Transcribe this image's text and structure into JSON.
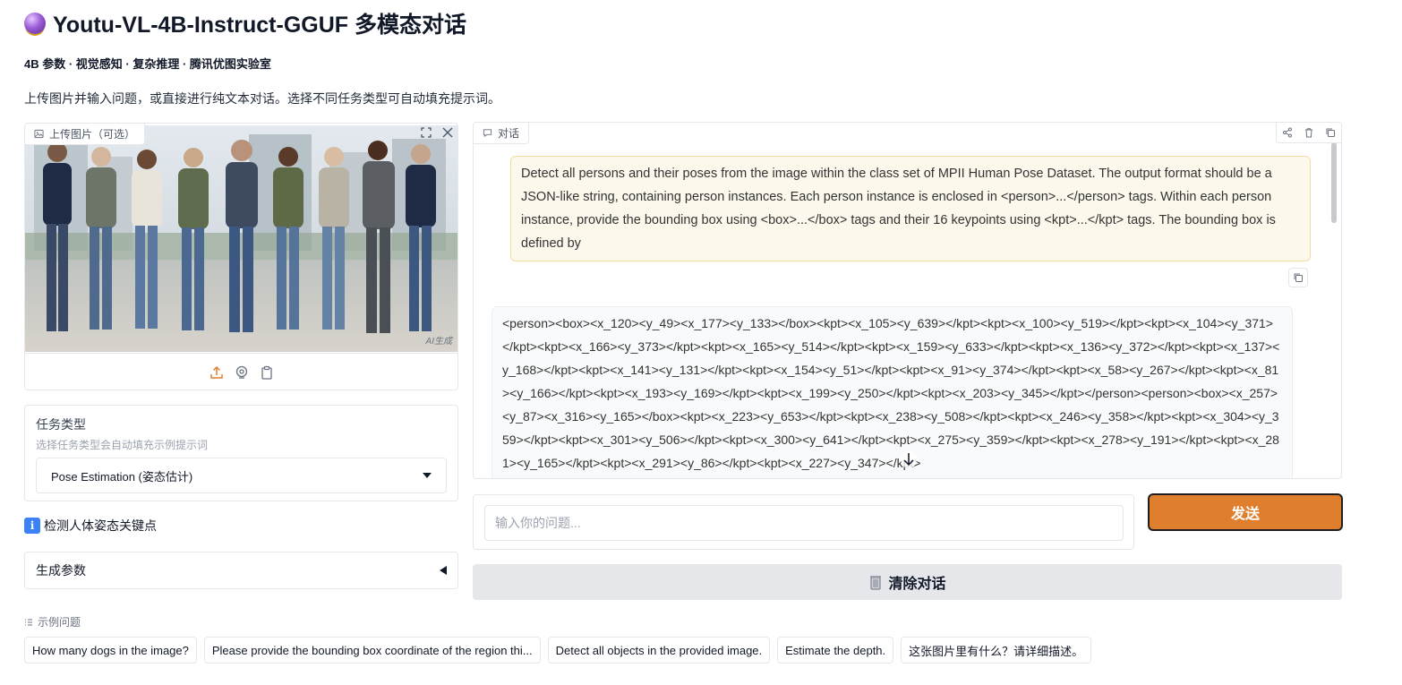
{
  "header": {
    "title": "Youtu-VL-4B-Instruct-GGUF 多模态对话",
    "subtitle": "4B 参数 · 视觉感知 · 复杂推理 · 腾讯优图实验室",
    "description": "上传图片并输入问题，或直接进行纯文本对话。选择不同任务类型可自动填充提示词。"
  },
  "image_upload": {
    "label": "上传图片（可选）",
    "watermark": "AI生成"
  },
  "task": {
    "label": "任务类型",
    "hint": "选择任务类型会自动填充示例提示词",
    "selected": "Pose Estimation (姿态估计)"
  },
  "info": {
    "text": "检测人体姿态关键点"
  },
  "gen_params": {
    "label": "生成参数"
  },
  "chat": {
    "label": "对话",
    "user_message": "Detect all persons and their poses from the image within the class set of MPII Human Pose Dataset. The output format should be a JSON-like string, containing person instances. Each person instance is enclosed in <person>...</person> tags. Within each person instance, provide the bounding box using <box>...</box> tags and their 16 keypoints using <kpt>...</kpt> tags. The bounding box is defined by",
    "bot_message": "<person><box><x_120><y_49><x_177><y_133></box><kpt><x_105><y_639></kpt><kpt><x_100><y_519></kpt><kpt><x_104><y_371></kpt><kpt><x_166><y_373></kpt><kpt><x_165><y_514></kpt><kpt><x_159><y_633></kpt><kpt><x_136><y_372></kpt><kpt><x_137><y_168></kpt><kpt><x_141><y_131></kpt><kpt><x_154><y_51></kpt><kpt><x_91><y_374></kpt><kpt><x_58><y_267></kpt><kpt><x_81><y_166></kpt><kpt><x_193><y_169></kpt><kpt><x_199><y_250></kpt><kpt><x_203><y_345></kpt></person><person><box><x_257><y_87><x_316><y_165></box><kpt><x_223><y_653></kpt><kpt><x_238><y_508></kpt><kpt><x_246><y_358></kpt><kpt><x_304><y_359></kpt><kpt><x_301><y_506></kpt><kpt><x_300><y_641></kpt><kpt><x_275><y_359></kpt><kpt><x_278><y_191></kpt><kpt><x_281><y_165></kpt><kpt><x_291><y_86></kpt><kpt><x_227><y_347></kpt>"
  },
  "input": {
    "placeholder": "输入你的问题..."
  },
  "buttons": {
    "send": "发送",
    "clear": "清除对话"
  },
  "examples": {
    "label": "示例问题",
    "items": [
      "How many dogs in the image?",
      "Please provide the bounding box coordinate of the region thi...",
      "Detect all objects in the provided image.",
      "Estimate the depth.",
      "这张图片里有什么？请详细描述。"
    ]
  },
  "colors": {
    "accent": "#df7f2e",
    "user_bubble": "#fdf8ec",
    "user_bubble_border": "#f2dca6"
  }
}
